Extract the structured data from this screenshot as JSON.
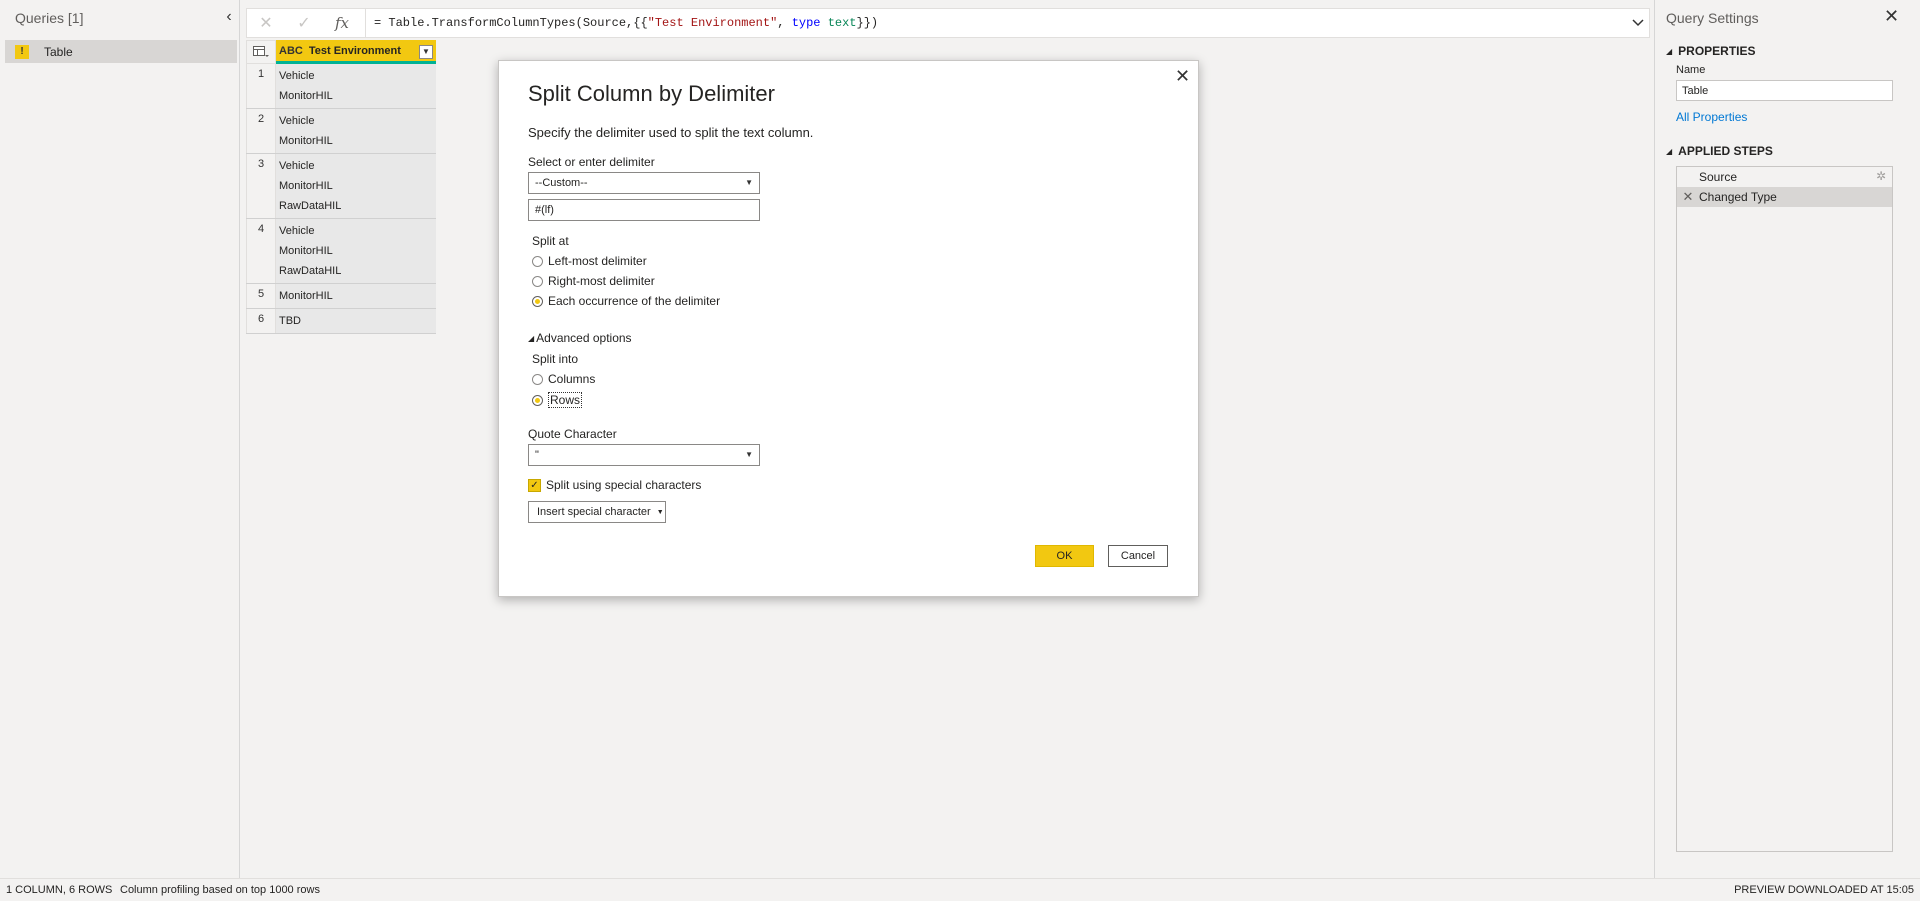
{
  "queries_pane": {
    "title": "Queries [1]",
    "collapse_icon": "chevron-left-icon",
    "items": [
      {
        "label": "Table",
        "icon": "warning-icon"
      }
    ]
  },
  "formula_bar": {
    "cancel_icon": "close-icon",
    "commit_icon": "checkmark-icon",
    "fx_label": "fx",
    "formula_prefix": "= Table.TransformColumnTypes(Source,{{",
    "formula_string": "\"Test Environment\"",
    "formula_comma": ", ",
    "formula_keyword": "type",
    "formula_space": " ",
    "formula_type": "text",
    "formula_suffix": "}})",
    "expand_icon": "chevron-down-icon"
  },
  "grid": {
    "column": {
      "type_label": "ABC",
      "name": "Test Environment"
    },
    "rows": [
      {
        "num": "1",
        "lines": [
          "Vehicle",
          "MonitorHIL"
        ]
      },
      {
        "num": "2",
        "lines": [
          "Vehicle",
          "MonitorHIL"
        ]
      },
      {
        "num": "3",
        "lines": [
          "Vehicle",
          "MonitorHIL",
          "RawDataHIL"
        ]
      },
      {
        "num": "4",
        "lines": [
          "Vehicle",
          "MonitorHIL",
          "RawDataHIL"
        ]
      },
      {
        "num": "5",
        "lines": [
          "MonitorHIL"
        ]
      },
      {
        "num": "6",
        "lines": [
          "TBD"
        ]
      }
    ]
  },
  "settings": {
    "title": "Query Settings",
    "properties_head": "PROPERTIES",
    "name_label": "Name",
    "name_value": "Table",
    "all_properties": "All Properties",
    "applied_steps_head": "APPLIED STEPS",
    "steps": [
      {
        "label": "Source",
        "selected": false
      },
      {
        "label": "Changed Type",
        "selected": true
      }
    ]
  },
  "status": {
    "columns_rows": "1 COLUMN, 6 ROWS",
    "profiling": "Column profiling based on top 1000 rows",
    "preview": "PREVIEW DOWNLOADED AT 15:05"
  },
  "dialog": {
    "title": "Split Column by Delimiter",
    "description": "Specify the delimiter used to split the text column.",
    "delimiter_label": "Select or enter delimiter",
    "delimiter_selected": "--Custom--",
    "custom_value": "#(lf)",
    "split_at_label": "Split at",
    "split_at_options": [
      "Left-most delimiter",
      "Right-most delimiter",
      "Each occurrence of the delimiter"
    ],
    "split_at_selected": 2,
    "advanced_label": "Advanced options",
    "split_into_label": "Split into",
    "split_into_options": [
      "Columns",
      "Rows"
    ],
    "split_into_selected": 1,
    "quote_label": "Quote Character",
    "quote_value": "\"",
    "special_chars_label": "Split using special characters",
    "special_chars_checked": true,
    "insert_special_label": "Insert special character",
    "ok_label": "OK",
    "cancel_label": "Cancel"
  },
  "colors": {
    "accent": "#f2c811",
    "link": "#0078d4",
    "column_quality": "#00b294"
  }
}
